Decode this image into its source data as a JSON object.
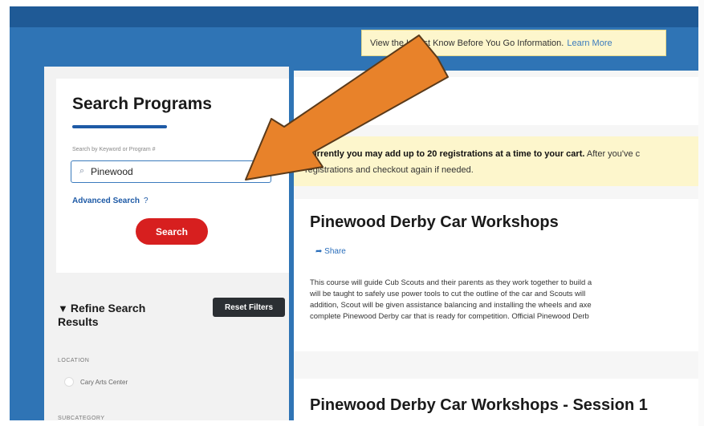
{
  "notice": {
    "text": "View the Latest Know Before You Go Information.",
    "link": "Learn More"
  },
  "sidebar": {
    "title": "Search Programs",
    "field_label": "Search by Keyword or Program #",
    "search_value": "Pinewood",
    "advanced_search": "Advanced Search",
    "advanced_help": "?",
    "search_button": "Search",
    "refine_title_line1": "Refine Search",
    "refine_title_line2": "Results",
    "reset_button": "Reset Filters",
    "location_label": "LOCATION",
    "location_item": "Cary Arts Center",
    "subcategory_label": "SUBCATEGORY"
  },
  "main": {
    "cart_banner_bold": "Currently you may add up to 20 registrations at a time to your cart.",
    "cart_banner_rest": " After you've c",
    "cart_banner_line2": "registrations and checkout again if needed.",
    "program_title": "Pinewood Derby Car Workshops",
    "share_label": "Share",
    "description_lines": [
      "This course will guide Cub Scouts and their parents as they work together to build a",
      "will be taught to safely use power tools to cut the outline of the car and Scouts will",
      "addition, Scout will be given assistance balancing and installing the wheels and axe",
      "complete Pinewood Derby car that is ready for competition. Official Pinewood Derb"
    ],
    "session_title": "Pinewood Derby Car Workshops - Session 1"
  },
  "colors": {
    "page_blue": "#2f74b5",
    "arrow_orange": "#e8822a",
    "search_button_red": "#d71f1f",
    "notice_yellow": "#fdf6cc"
  },
  "icons": [
    "search-icon",
    "clear-icon",
    "help-icon",
    "share-icon",
    "filter-icon",
    "arrow-annotation-icon"
  ]
}
